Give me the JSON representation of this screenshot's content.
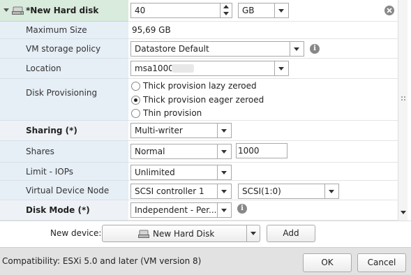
{
  "header": {
    "device_label": "*New Hard disk",
    "size_value": "40",
    "size_unit": "GB"
  },
  "rows": {
    "max_size": {
      "label": "Maximum Size",
      "value": "95,69 GB"
    },
    "storage_policy": {
      "label": "VM storage policy",
      "value": "Datastore Default"
    },
    "location": {
      "label": "Location",
      "value": "msa1000"
    },
    "provisioning": {
      "label": "Disk Provisioning",
      "options": [
        "Thick provision lazy zeroed",
        "Thick provision eager zeroed",
        "Thin provision"
      ],
      "selected": "Thick provision eager zeroed"
    },
    "sharing": {
      "label": "Sharing (*)",
      "value": "Multi-writer"
    },
    "shares": {
      "label": "Shares",
      "value": "Normal",
      "amount": "1000"
    },
    "limit": {
      "label": "Limit - IOPs",
      "value": "Unlimited"
    },
    "vdn": {
      "label": "Virtual Device Node",
      "controller": "SCSI controller 1",
      "slot": "SCSI(1:0)"
    },
    "disk_mode": {
      "label": "Disk Mode (*)",
      "value": "Independent - Per..."
    }
  },
  "new_device": {
    "label": "New device:",
    "value": "New Hard Disk",
    "add_label": "Add"
  },
  "footer": {
    "compatibility": "Compatibility: ESXi 5.0 and later (VM version 8)",
    "ok_label": "OK",
    "cancel_label": "Cancel"
  }
}
